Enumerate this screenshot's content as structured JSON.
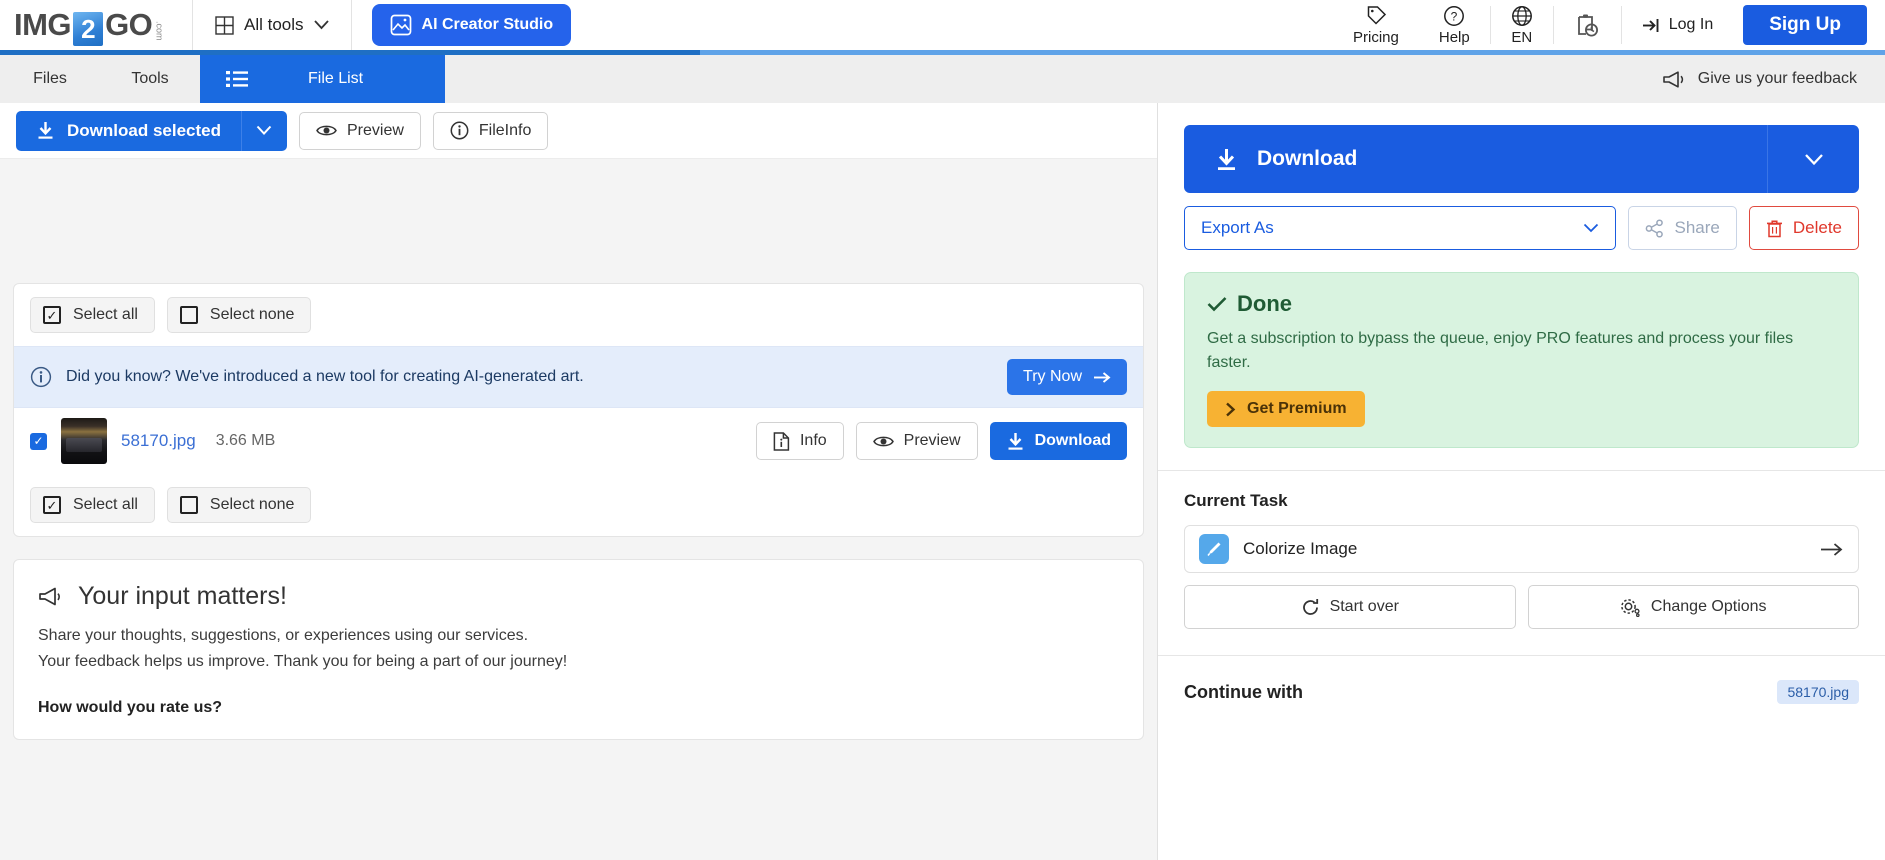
{
  "header": {
    "logo": {
      "part1": "IMG",
      "two": "2",
      "part2": "GO",
      "dotcom": ".com"
    },
    "all_tools": "All tools",
    "ai_studio": "AI Creator Studio",
    "pricing": "Pricing",
    "help": "Help",
    "language": "EN",
    "login": "Log In",
    "signup": "Sign Up"
  },
  "tabs": {
    "files": "Files",
    "tools": "Tools",
    "file_list": "File List",
    "feedback_link": "Give us your feedback"
  },
  "toolbar": {
    "download_selected": "Download selected",
    "preview": "Preview",
    "fileinfo": "FileInfo"
  },
  "file_card": {
    "select_all": "Select all",
    "select_none": "Select none",
    "notice": "Did you know? We've introduced a new tool for creating AI-generated art.",
    "try_now": "Try Now",
    "file": {
      "name": "58170.jpg",
      "size": "3.66 MB",
      "info": "Info",
      "preview": "Preview",
      "download": "Download"
    }
  },
  "feedback": {
    "title": "Your input matters!",
    "line1": "Share your thoughts, suggestions, or experiences using our services.",
    "line2": "Your feedback helps us improve. Thank you for being a part of our journey!",
    "rate_question": "How would you rate us?"
  },
  "sidebar": {
    "download": "Download",
    "export_as": "Export As",
    "share": "Share",
    "delete": "Delete",
    "done": {
      "title": "Done",
      "text": "Get a subscription to bypass the queue, enjoy PRO features and process your files faster.",
      "premium_button": "Get Premium"
    },
    "current_task_title": "Current Task",
    "task_name": "Colorize Image",
    "start_over": "Start over",
    "change_options": "Change Options",
    "continue_with": "Continue with",
    "continue_file": "58170.jpg"
  },
  "colors": {
    "brand_blue": "#1a6ae0",
    "signup_blue": "#1a5ce0",
    "done_green_bg": "#d9f3e0",
    "premium_orange": "#f7b233",
    "delete_red": "#e0382c"
  }
}
